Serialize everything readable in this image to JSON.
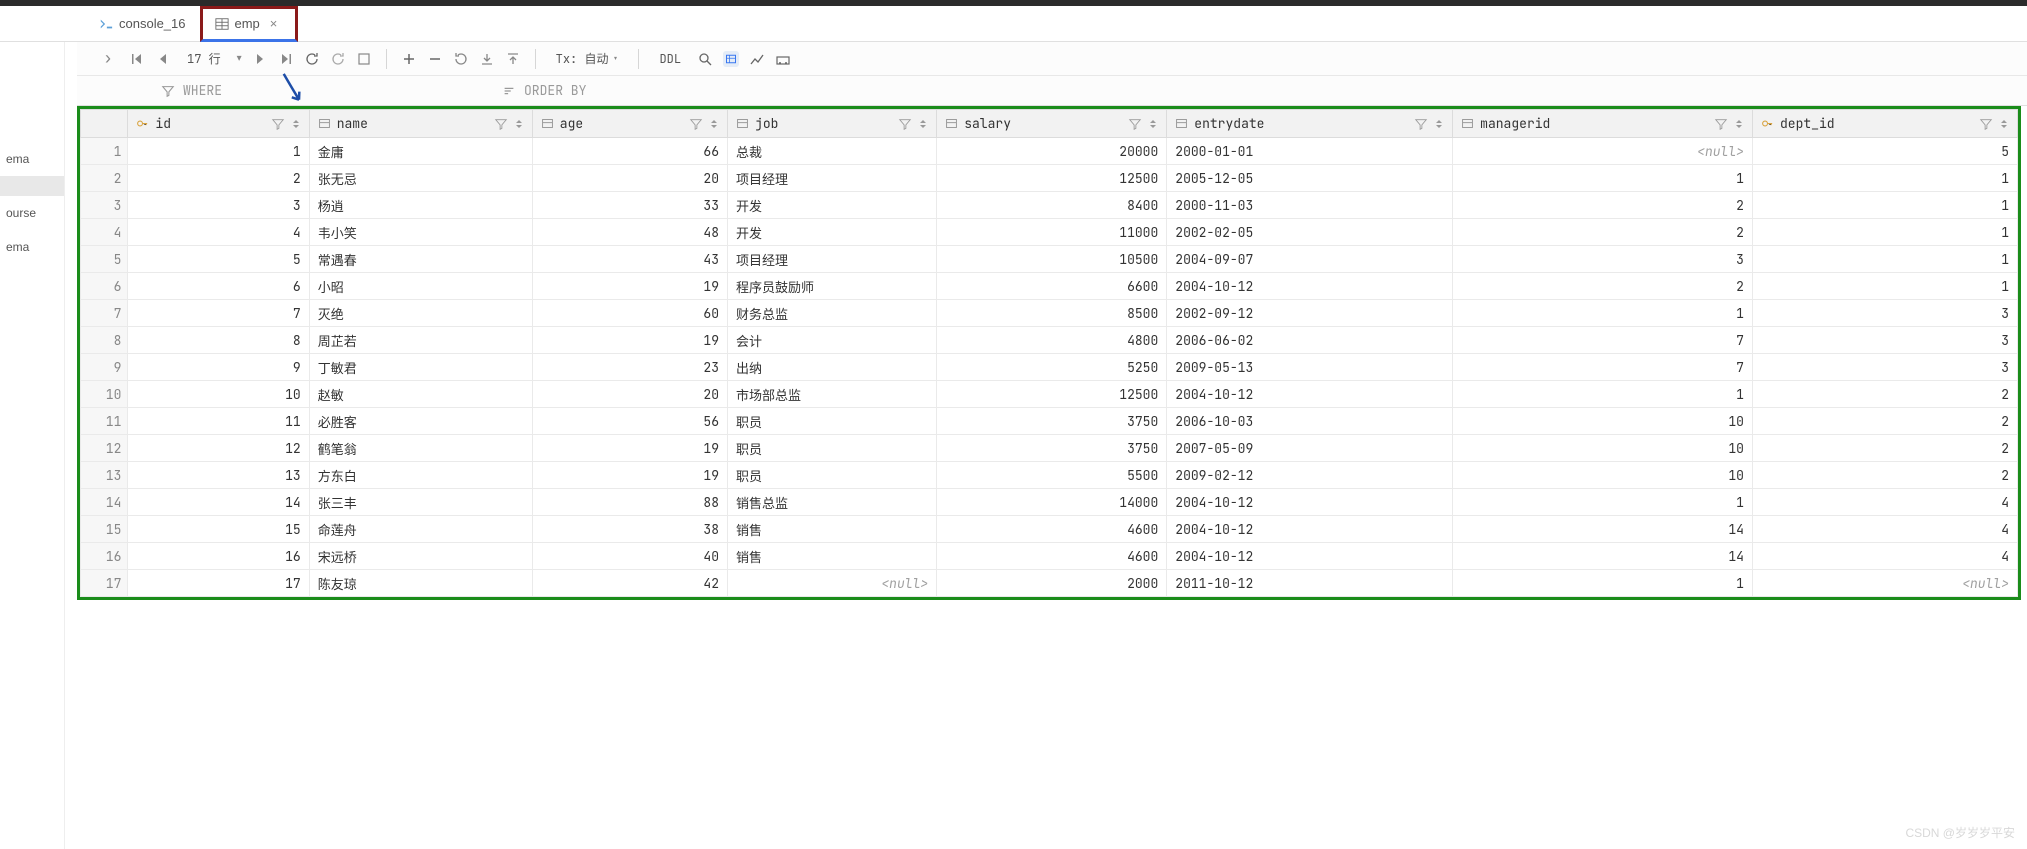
{
  "tabs": [
    {
      "label": "console_16",
      "icon": "db",
      "active": false
    },
    {
      "label": "emp",
      "icon": "table",
      "active": true
    }
  ],
  "toolbar": {
    "rowcount": "17 行",
    "tx_label": "Tx: 自动",
    "ddl": "DDL"
  },
  "filterbar": {
    "where": "WHERE",
    "orderby": "ORDER BY"
  },
  "sidebar": {
    "items": [
      "ema",
      "",
      "ourse",
      "ema"
    ]
  },
  "columns": [
    {
      "key": "id",
      "label": "id"
    },
    {
      "key": "name",
      "label": "name"
    },
    {
      "key": "age",
      "label": "age"
    },
    {
      "key": "job",
      "label": "job"
    },
    {
      "key": "salary",
      "label": "salary"
    },
    {
      "key": "entrydate",
      "label": "entrydate"
    },
    {
      "key": "managerid",
      "label": "managerid"
    },
    {
      "key": "dept_id",
      "label": "dept_id"
    }
  ],
  "rows": [
    {
      "n": 1,
      "id": 1,
      "name": "金庸",
      "age": 66,
      "job": "总裁",
      "salary": 20000,
      "entrydate": "2000-01-01",
      "managerid": null,
      "dept_id": 5
    },
    {
      "n": 2,
      "id": 2,
      "name": "张无忌",
      "age": 20,
      "job": "项目经理",
      "salary": 12500,
      "entrydate": "2005-12-05",
      "managerid": 1,
      "dept_id": 1
    },
    {
      "n": 3,
      "id": 3,
      "name": "杨逍",
      "age": 33,
      "job": "开发",
      "salary": 8400,
      "entrydate": "2000-11-03",
      "managerid": 2,
      "dept_id": 1
    },
    {
      "n": 4,
      "id": 4,
      "name": "韦小笑",
      "age": 48,
      "job": "开发",
      "salary": 11000,
      "entrydate": "2002-02-05",
      "managerid": 2,
      "dept_id": 1
    },
    {
      "n": 5,
      "id": 5,
      "name": "常遇春",
      "age": 43,
      "job": "项目经理",
      "salary": 10500,
      "entrydate": "2004-09-07",
      "managerid": 3,
      "dept_id": 1
    },
    {
      "n": 6,
      "id": 6,
      "name": "小昭",
      "age": 19,
      "job": "程序员鼓励师",
      "salary": 6600,
      "entrydate": "2004-10-12",
      "managerid": 2,
      "dept_id": 1
    },
    {
      "n": 7,
      "id": 7,
      "name": "灭绝",
      "age": 60,
      "job": "财务总监",
      "salary": 8500,
      "entrydate": "2002-09-12",
      "managerid": 1,
      "dept_id": 3
    },
    {
      "n": 8,
      "id": 8,
      "name": "周芷若",
      "age": 19,
      "job": "会计",
      "salary": 4800,
      "entrydate": "2006-06-02",
      "managerid": 7,
      "dept_id": 3
    },
    {
      "n": 9,
      "id": 9,
      "name": "丁敏君",
      "age": 23,
      "job": "出纳",
      "salary": 5250,
      "entrydate": "2009-05-13",
      "managerid": 7,
      "dept_id": 3
    },
    {
      "n": 10,
      "id": 10,
      "name": "赵敏",
      "age": 20,
      "job": "市场部总监",
      "salary": 12500,
      "entrydate": "2004-10-12",
      "managerid": 1,
      "dept_id": 2
    },
    {
      "n": 11,
      "id": 11,
      "name": "必胜客",
      "age": 56,
      "job": "职员",
      "salary": 3750,
      "entrydate": "2006-10-03",
      "managerid": 10,
      "dept_id": 2
    },
    {
      "n": 12,
      "id": 12,
      "name": "鹤笔翁",
      "age": 19,
      "job": "职员",
      "salary": 3750,
      "entrydate": "2007-05-09",
      "managerid": 10,
      "dept_id": 2
    },
    {
      "n": 13,
      "id": 13,
      "name": "方东白",
      "age": 19,
      "job": "职员",
      "salary": 5500,
      "entrydate": "2009-02-12",
      "managerid": 10,
      "dept_id": 2
    },
    {
      "n": 14,
      "id": 14,
      "name": "张三丰",
      "age": 88,
      "job": "销售总监",
      "salary": 14000,
      "entrydate": "2004-10-12",
      "managerid": 1,
      "dept_id": 4
    },
    {
      "n": 15,
      "id": 15,
      "name": "命莲舟",
      "age": 38,
      "job": "销售",
      "salary": 4600,
      "entrydate": "2004-10-12",
      "managerid": 14,
      "dept_id": 4
    },
    {
      "n": 16,
      "id": 16,
      "name": "宋远桥",
      "age": 40,
      "job": "销售",
      "salary": 4600,
      "entrydate": "2004-10-12",
      "managerid": 14,
      "dept_id": 4
    },
    {
      "n": 17,
      "id": 17,
      "name": "陈友琼",
      "age": 42,
      "job": null,
      "salary": 2000,
      "entrydate": "2011-10-12",
      "managerid": 1,
      "dept_id": null
    }
  ],
  "null_text": "<null>",
  "watermark": "CSDN @岁岁岁平安"
}
